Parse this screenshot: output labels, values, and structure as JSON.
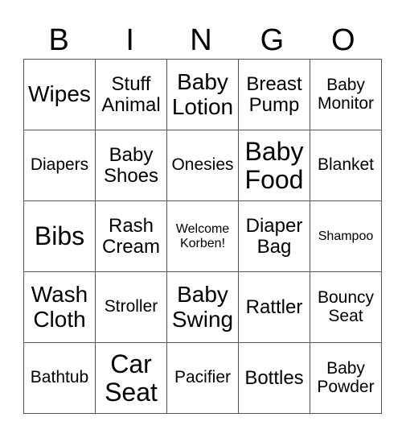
{
  "header": {
    "letters": [
      "B",
      "I",
      "N",
      "G",
      "O"
    ]
  },
  "grid": {
    "rows": [
      [
        {
          "text": "Wipes",
          "size": "s-l"
        },
        {
          "text": "Stuff Animal",
          "size": "s-m"
        },
        {
          "text": "Baby Lotion",
          "size": "s-l"
        },
        {
          "text": "Breast Pump",
          "size": "s-m"
        },
        {
          "text": "Baby Monitor",
          "size": "s-s"
        }
      ],
      [
        {
          "text": "Diapers",
          "size": "s-s"
        },
        {
          "text": "Baby Shoes",
          "size": "s-m"
        },
        {
          "text": "Onesies",
          "size": "s-s"
        },
        {
          "text": "Baby Food",
          "size": "s-xl"
        },
        {
          "text": "Blanket",
          "size": "s-s"
        }
      ],
      [
        {
          "text": "Bibs",
          "size": "s-xl"
        },
        {
          "text": "Rash Cream",
          "size": "s-m"
        },
        {
          "text": "Welcome Korben!",
          "size": "s-xxs"
        },
        {
          "text": "Diaper Bag",
          "size": "s-m"
        },
        {
          "text": "Shampoo",
          "size": "s-xxs"
        }
      ],
      [
        {
          "text": "Wash Cloth",
          "size": "s-l"
        },
        {
          "text": "Stroller",
          "size": "s-s"
        },
        {
          "text": "Baby Swing",
          "size": "s-l"
        },
        {
          "text": "Rattler",
          "size": "s-m"
        },
        {
          "text": "Bouncy Seat",
          "size": "s-s"
        }
      ],
      [
        {
          "text": "Bathtub",
          "size": "s-s"
        },
        {
          "text": "Car Seat",
          "size": "s-xl"
        },
        {
          "text": "Pacifier",
          "size": "s-s"
        },
        {
          "text": "Bottles",
          "size": "s-m"
        },
        {
          "text": "Baby Powder",
          "size": "s-s"
        }
      ]
    ]
  }
}
